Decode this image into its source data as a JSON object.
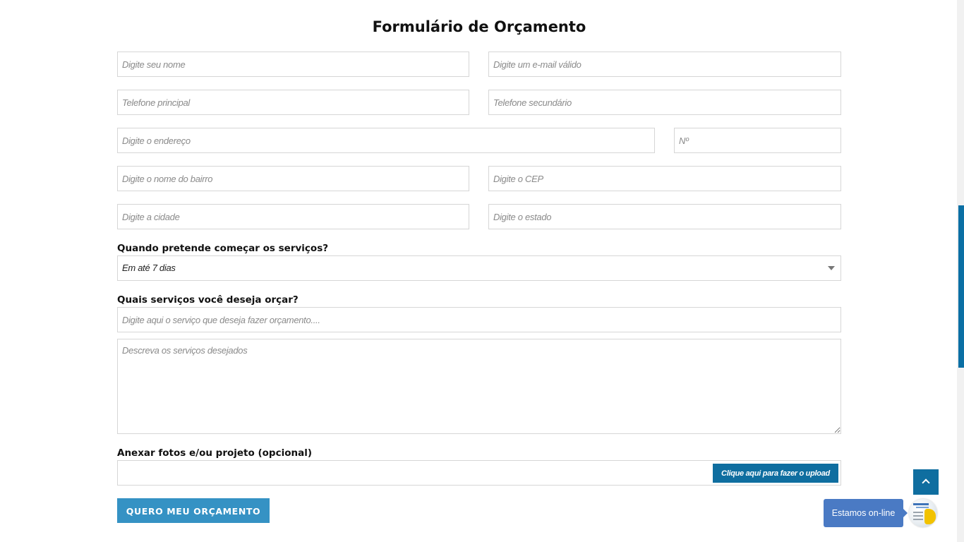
{
  "form": {
    "title": "Formulário de Orçamento",
    "fields": {
      "name": {
        "placeholder": "Digite seu nome",
        "value": ""
      },
      "email": {
        "placeholder": "Digite um e-mail válido",
        "value": ""
      },
      "phone_main": {
        "placeholder": "Telefone principal",
        "value": ""
      },
      "phone_secondary": {
        "placeholder": "Telefone secundário",
        "value": ""
      },
      "address": {
        "placeholder": "Digite o endereço",
        "value": ""
      },
      "number": {
        "placeholder": "Nº",
        "value": ""
      },
      "neighborhood": {
        "placeholder": "Digite o nome do bairro",
        "value": ""
      },
      "cep": {
        "placeholder": "Digite o CEP",
        "value": ""
      },
      "city": {
        "placeholder": "Digite a cidade",
        "value": ""
      },
      "state": {
        "placeholder": "Digite o estado",
        "value": ""
      }
    },
    "start_question": {
      "label": "Quando pretende começar os serviços?",
      "selected": "Em até 7 dias"
    },
    "services_question": {
      "label": "Quais serviços você deseja orçar?",
      "service_placeholder": "Digite aqui o serviço que deseja fazer orçamento....",
      "description_placeholder": "Descreva os serviços desejados"
    },
    "attachments": {
      "label": "Anexar fotos e/ou projeto  (opcional)",
      "upload_label": "Clique aqui para fazer o upload"
    },
    "submit_label": "QUERO MEU ORÇAMENTO"
  },
  "widgets": {
    "back_to_top_icon": "chevron-up-icon",
    "chat_label": "Estamos on-line"
  },
  "colors": {
    "primary": "#0f6ea0",
    "submit": "#3592c4",
    "chat": "#4a7ac4"
  }
}
